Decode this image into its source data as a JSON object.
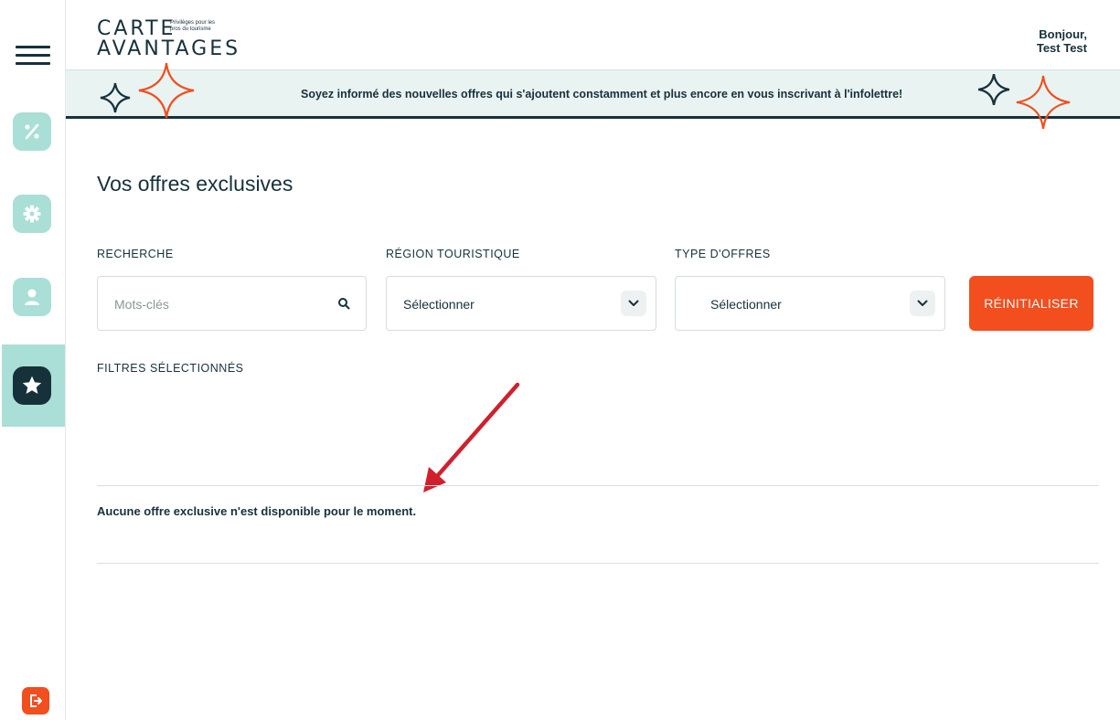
{
  "brand": {
    "logo_line1": "CARTE",
    "logo_line2": "AVANTAGES",
    "tagline": "Privilèges pour les pros du tourisme"
  },
  "header": {
    "greeting": "Bonjour,",
    "user_name": "Test Test"
  },
  "banner": {
    "text": "Soyez informé des nouvelles offres qui s'ajoutent constamment et plus encore en vous inscrivant à l'infolettre!"
  },
  "sidebar": {
    "items": [
      {
        "icon": "percent-icon",
        "active": false
      },
      {
        "icon": "gear-icon",
        "active": false
      },
      {
        "icon": "user-icon",
        "active": false
      },
      {
        "icon": "star-icon",
        "active": true
      }
    ],
    "logout_icon": "logout-icon"
  },
  "main": {
    "title": "Vos offres exclusives",
    "filters": {
      "search_label": "RECHERCHE",
      "search_placeholder": "Mots-clés",
      "region_label": "RÉGION TOURISTIQUE",
      "region_value": "Sélectionner",
      "type_label": "TYPE D'OFFRES",
      "type_value": "Sélectionner",
      "reset_label": "RÉINITIALISER"
    },
    "selected_filters_label": "FILTRES SÉLECTIONNÉS",
    "empty_message": "Aucune offre exclusive n'est disponible pour le moment."
  },
  "colors": {
    "primary": "#17313b",
    "accent": "#f24e1e",
    "mint": "#a9dfd6",
    "banner_bg": "#e9f3f2",
    "annotation_arrow": "#d0202e"
  }
}
